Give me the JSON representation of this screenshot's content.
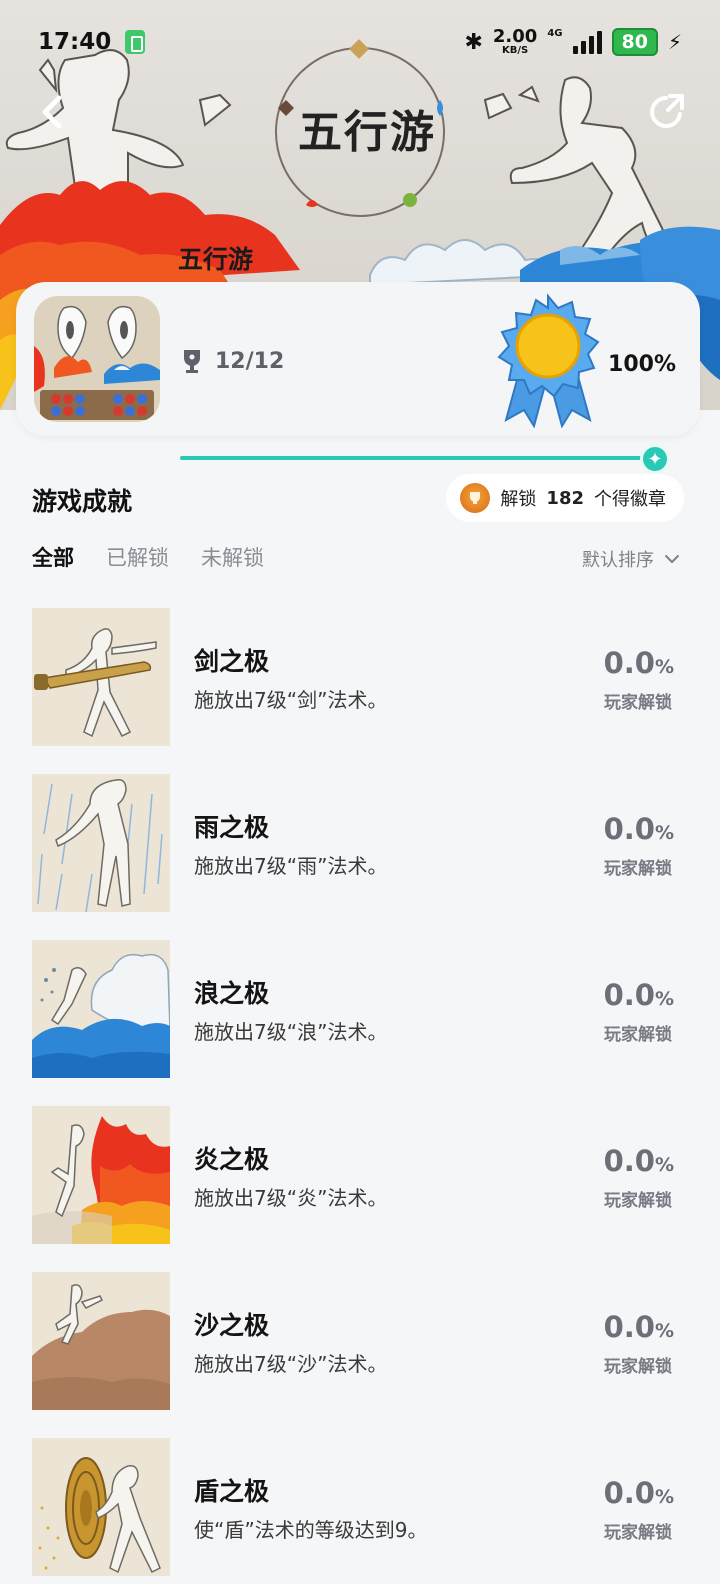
{
  "status_bar": {
    "time": "17:40",
    "net_speed": "2.00",
    "net_unit": "KB/S",
    "network": "4G",
    "battery": "80"
  },
  "hero": {
    "logo_text": "五行游",
    "game_name": "五行游"
  },
  "summary": {
    "trophy_count": "12/12",
    "percent": "100%",
    "progress": 1.0
  },
  "section": {
    "title": "游戏成就",
    "unlock_prefix": "解锁",
    "unlock_count": "182",
    "unlock_suffix": "个得徽章"
  },
  "tabs": [
    {
      "label": "全部",
      "active": true
    },
    {
      "label": "已解锁",
      "active": false
    },
    {
      "label": "未解锁",
      "active": false
    }
  ],
  "sort": {
    "label": "默认排序"
  },
  "achievements": [
    {
      "name": "剑之极",
      "desc": "施放出7级“剑”法术。",
      "pct": "0.0",
      "pct_unit": "%",
      "label": "玩家解锁",
      "art": "sword"
    },
    {
      "name": "雨之极",
      "desc": "施放出7级“雨”法术。",
      "pct": "0.0",
      "pct_unit": "%",
      "label": "玩家解锁",
      "art": "rain"
    },
    {
      "name": "浪之极",
      "desc": "施放出7级“浪”法术。",
      "pct": "0.0",
      "pct_unit": "%",
      "label": "玩家解锁",
      "art": "wave"
    },
    {
      "name": "炎之极",
      "desc": "施放出7级“炎”法术。",
      "pct": "0.0",
      "pct_unit": "%",
      "label": "玩家解锁",
      "art": "fire"
    },
    {
      "name": "沙之极",
      "desc": "施放出7级“沙”法术。",
      "pct": "0.0",
      "pct_unit": "%",
      "label": "玩家解锁",
      "art": "sand"
    },
    {
      "name": "盾之极",
      "desc": "使“盾”法术的等级达到9。",
      "pct": "0.0",
      "pct_unit": "%",
      "label": "玩家解锁",
      "art": "shield"
    }
  ],
  "colors": {
    "accent": "#2ac9b6",
    "background": "#f5f6f8",
    "badge_orange": "#e07b20",
    "medal_blue": "#4a9be3",
    "medal_gold": "#f7c21a"
  }
}
